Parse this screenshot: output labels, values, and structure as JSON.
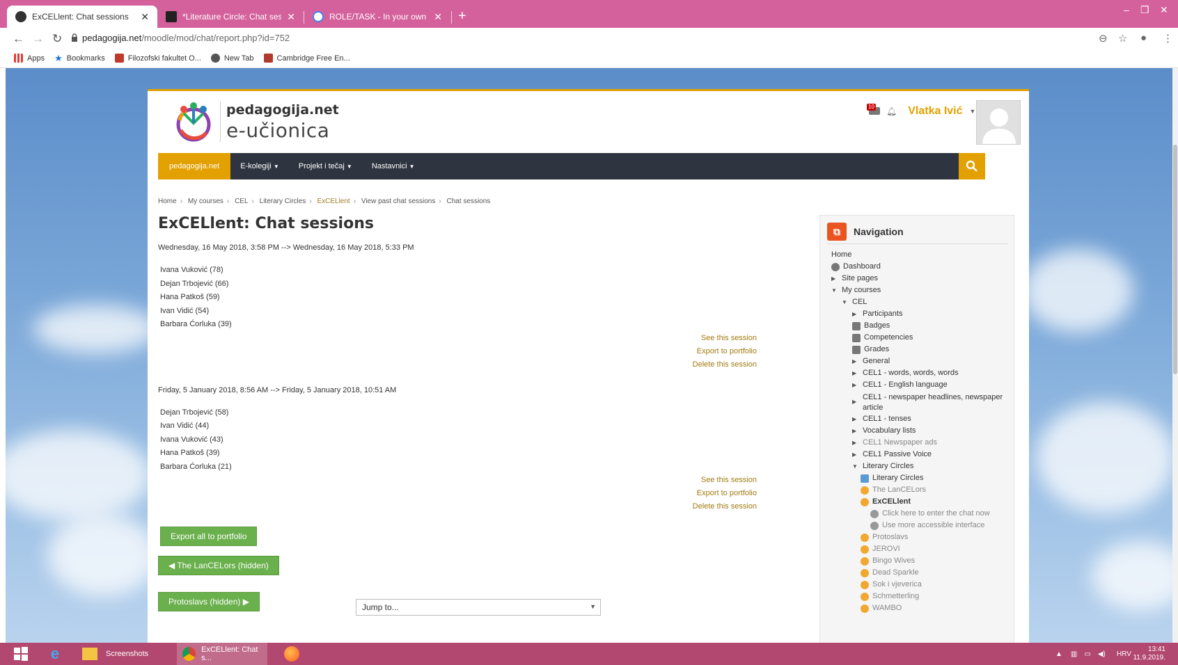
{
  "browser": {
    "tabs": [
      {
        "title": "ExCELlent: Chat sessions",
        "active": true
      },
      {
        "title": "*Literature Circle: Chat sessions",
        "active": false
      },
      {
        "title": "ROLE/TASK - In your own words.",
        "active": false
      }
    ],
    "url_host": "pedagogija.net",
    "url_path": "/moodle/mod/chat/report.php?id=752",
    "bookmarks": [
      "Apps",
      "Bookmarks",
      "Filozofski fakultet O...",
      "New Tab",
      "Cambridge Free En..."
    ]
  },
  "site": {
    "brand_line1": "pedagogija.net",
    "brand_line2": "e-učionica",
    "notification_count": "10",
    "user_name": "Vlatka Ivić",
    "nav": {
      "home": "pedagogija.net",
      "items": [
        "E-kolegiji",
        "Projekt i tečaj",
        "Nastavnici"
      ]
    }
  },
  "breadcrumb": [
    "Home",
    "My courses",
    "CEL",
    "Literary Circles",
    "ExCELlent",
    "View past chat sessions",
    "Chat sessions"
  ],
  "main": {
    "title": "ExCELlent: Chat sessions",
    "sessions": [
      {
        "date": "Wednesday, 16 May 2018, 3:58 PM --> Wednesday, 16 May 2018, 5:33 PM",
        "participants": [
          "Ivana Vuković (78)",
          "Dejan Trbojević (66)",
          "Hana Patkoš (59)",
          "Ivan Vidić (54)",
          "Barbara Ćorluka (39)"
        ]
      },
      {
        "date": "Friday, 5 January 2018, 8:56 AM --> Friday, 5 January 2018, 10:51 AM",
        "participants": [
          "Dejan Trbojević (58)",
          "Ivan Vidić (44)",
          "Ivana Vuković (43)",
          "Hana Patkoš (39)",
          "Barbara Ćorluka (21)"
        ]
      }
    ],
    "actions": {
      "see": "See this session",
      "export": "Export to portfolio",
      "delete": "Delete this session"
    },
    "export_all": "Export all to portfolio",
    "prev_activity": "◀ The LanCELors (hidden)",
    "next_activity": "Protoslavs (hidden) ▶",
    "jump_to": "Jump to..."
  },
  "navigation": {
    "title": "Navigation",
    "items": [
      "Home",
      "Dashboard",
      "Site pages",
      "My courses",
      "CEL",
      "Participants",
      "Badges",
      "Competencies",
      "Grades",
      "General",
      "CEL1 - words, words, words",
      "CEL1 - English language",
      "CEL1 - newspaper headlines, newspaper",
      "article",
      "CEL1 - tenses",
      "Vocabulary lists",
      "CEL1 Newspaper ads",
      "CEL1 Passive Voice",
      "Literary Circles",
      "Literary Circles",
      "The LanCELors",
      "ExCELlent",
      "Click here to enter the chat now",
      "Use more accessible interface",
      "Protoslavs",
      "JEROVI",
      "Bingo Wives",
      "Dead Sparkle",
      "Sok i vjeverica",
      "Schmetterling",
      "WAMBO"
    ]
  },
  "taskbar": {
    "items": [
      "Screenshots",
      "ExCELlent: Chat s..."
    ],
    "lang": "HRV",
    "time": "13:41",
    "date": "11.9.2019."
  },
  "colors": {
    "accent": "#e2a100",
    "navbar": "#2f3540",
    "green": "#6ab04c",
    "tabbar": "#d4609c",
    "taskbar": "#b2486f"
  }
}
